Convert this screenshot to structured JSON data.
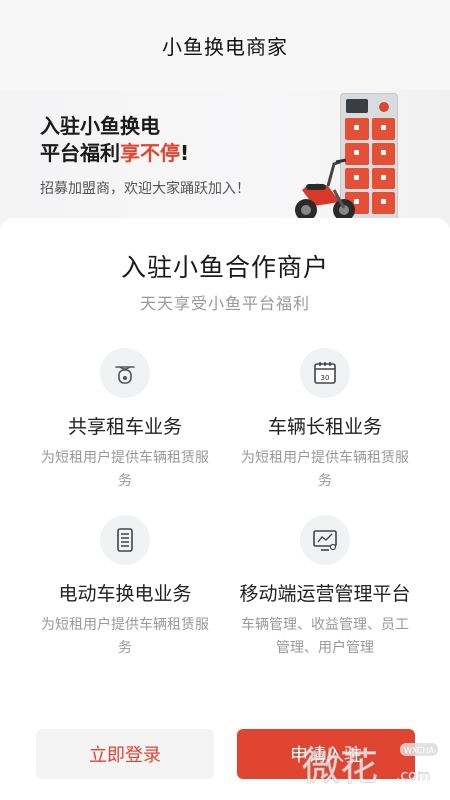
{
  "header": {
    "title": "小鱼换电商家"
  },
  "banner": {
    "line1": "入驻小鱼换电",
    "line2_prefix": "平台福利",
    "line2_highlight": "享不停",
    "line2_suffix": "!",
    "subtitle": "招募加盟商，欢迎大家踊跃加入！",
    "accent_color": "#e04532"
  },
  "section": {
    "title": "入驻小鱼合作商户",
    "subtitle": "天天享受小鱼平台福利"
  },
  "features": [
    {
      "icon": "scooter-icon",
      "title": "共享租车业务",
      "desc": "为短租用户提供车辆租赁服务"
    },
    {
      "icon": "calendar-icon",
      "title": "车辆长租业务",
      "desc": "为短租用户提供车辆租赁服务"
    },
    {
      "icon": "battery-cabinet-icon",
      "title": "电动车换电业务",
      "desc": "为短租用户提供车辆租赁服务"
    },
    {
      "icon": "monitor-chart-icon",
      "title": "移动端运营管理平台",
      "desc": "车辆管理、收益管理、员工管理、用户管理"
    }
  ],
  "calendar_icon_day": "30",
  "buttons": {
    "login": "立即登录",
    "apply": "申请入驻"
  },
  "watermark": {
    "text": "微花",
    "badge": "WXCHA",
    "domain": ".com"
  },
  "colors": {
    "primary": "#e04532",
    "muted": "#999999",
    "bg_light": "#f7f7f8"
  }
}
